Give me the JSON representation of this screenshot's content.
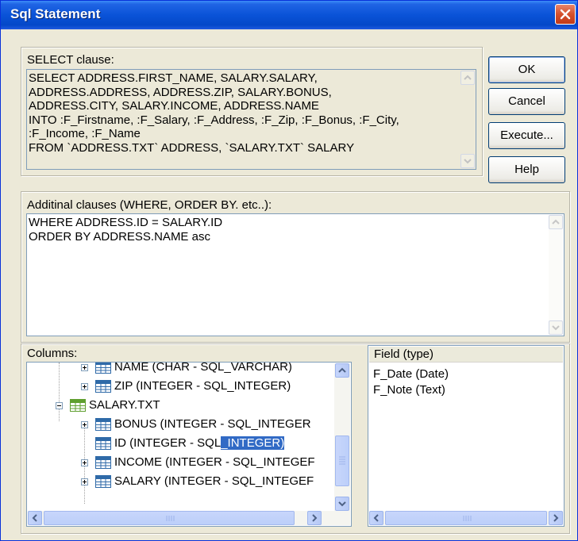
{
  "window": {
    "title": "Sql Statement",
    "close_icon": "close-icon"
  },
  "select_clause": {
    "label": "SELECT clause:",
    "lines": [
      "SELECT ADDRESS.FIRST_NAME, SALARY.SALARY,",
      "ADDRESS.ADDRESS, ADDRESS.ZIP, SALARY.BONUS,",
      "ADDRESS.CITY, SALARY.INCOME, ADDRESS.NAME",
      "INTO :F_Firstname, :F_Salary, :F_Address, :F_Zip, :F_Bonus, :F_City,",
      ":F_Income, :F_Name",
      "FROM `ADDRESS.TXT` ADDRESS, `SALARY.TXT` SALARY"
    ]
  },
  "buttons": {
    "ok": "OK",
    "cancel": "Cancel",
    "execute": "Execute...",
    "help": "Help"
  },
  "additional": {
    "label": "Additinal clauses (WHERE, ORDER BY. etc..):",
    "lines": [
      "WHERE ADDRESS.ID = SALARY.ID",
      "ORDER BY ADDRESS.NAME asc"
    ]
  },
  "columns": {
    "label": "Columns:",
    "tree": [
      {
        "text": "NAME (CHAR - SQL_VARCHAR)",
        "kind": "field",
        "expander": "plus"
      },
      {
        "text": "ZIP (INTEGER - SQL_INTEGER)",
        "kind": "field",
        "expander": "plus"
      },
      {
        "text": "SALARY.TXT",
        "kind": "table",
        "expander": "minus"
      },
      {
        "text": "BONUS (INTEGER - SQL_INTEGER",
        "kind": "field",
        "expander": "plus"
      },
      {
        "text": "ID (INTEGER - SQL",
        "highlight": "_INTEGER)",
        "kind": "field",
        "expander": "none"
      },
      {
        "text": "INCOME (INTEGER - SQL_INTEGEF",
        "kind": "field",
        "expander": "plus"
      },
      {
        "text": "SALARY (INTEGER - SQL_INTEGEF",
        "kind": "field",
        "expander": "plus"
      }
    ]
  },
  "fields": {
    "header": "Field (type)",
    "items": [
      "F_Date (Date)",
      "F_Note (Text)"
    ]
  },
  "colors": {
    "selection": "#316ac5",
    "title_bar": "#0a53d8",
    "dialog_bg": "#ece9d8"
  }
}
